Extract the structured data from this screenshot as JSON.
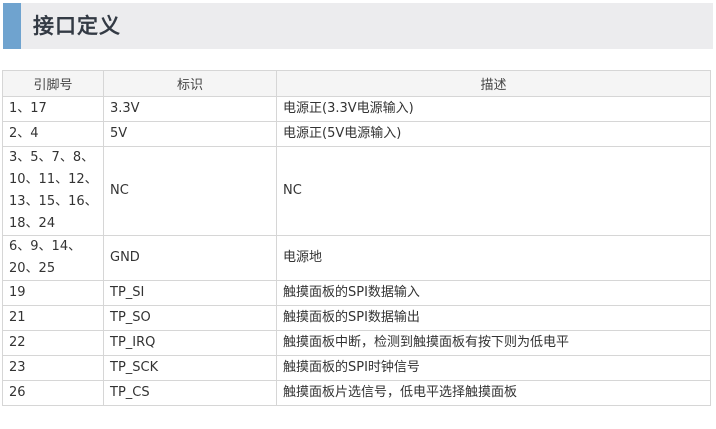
{
  "header": {
    "title": "接口定义",
    "accent_color": "#6fa3cf"
  },
  "table": {
    "columns": [
      "引脚号",
      "标识",
      "描述"
    ],
    "rows": [
      {
        "pin": "1、17",
        "label": "3.3V",
        "desc": "电源正(3.3V电源输入)"
      },
      {
        "pin": "2、4",
        "label": "5V",
        "desc": "电源正(5V电源输入)"
      },
      {
        "pin": "3、5、7、8、10、11、12、13、15、16、18、24",
        "label": "NC",
        "desc": "NC"
      },
      {
        "pin": "6、9、14、20、25",
        "label": "GND",
        "desc": "电源地"
      },
      {
        "pin": "19",
        "label": "TP_SI",
        "desc": "触摸面板的SPI数据输入"
      },
      {
        "pin": "21",
        "label": "TP_SO",
        "desc": "触摸面板的SPI数据输出"
      },
      {
        "pin": "22",
        "label": "TP_IRQ",
        "desc": "触摸面板中断，检测到触摸面板有按下则为低电平"
      },
      {
        "pin": "23",
        "label": "TP_SCK",
        "desc": "触摸面板的SPI时钟信号"
      },
      {
        "pin": "26",
        "label": "TP_CS",
        "desc": "触摸面板片选信号，低电平选择触摸面板"
      }
    ]
  }
}
